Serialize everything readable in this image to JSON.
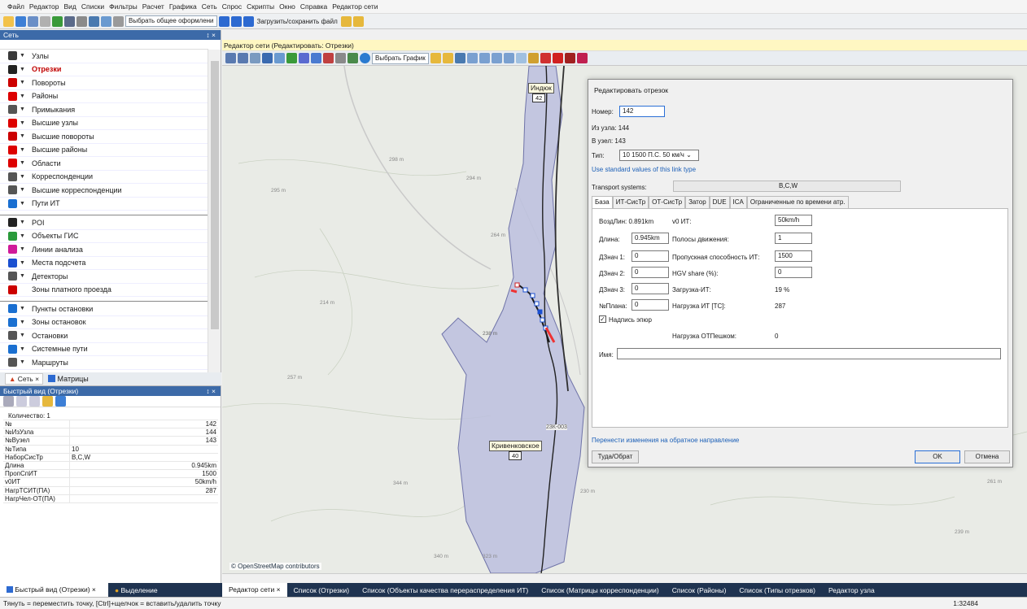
{
  "menubar": [
    "Файл",
    "Редактор",
    "Вид",
    "Списки",
    "Фильтры",
    "Расчет",
    "Графика",
    "Сеть",
    "Спрос",
    "Скрипты",
    "Окно",
    "Справка",
    "Редактор сети"
  ],
  "toolbar": {
    "layout_combo": "Выбрать общее оформлени",
    "load_save": "Загрузить/сохранить файл"
  },
  "net_pane": {
    "title": "Сеть",
    "pin": "↕ ×"
  },
  "net_items": [
    {
      "label": "Узлы",
      "icon": "node-arrow-icon",
      "color": "#3a3a3a"
    },
    {
      "label": "Отрезки",
      "icon": "link-icon",
      "color": "#222",
      "selected": true
    },
    {
      "label": "Повороты",
      "icon": "turn-icon",
      "color": "#c00"
    },
    {
      "label": "Районы",
      "icon": "zone-icon",
      "color": "#d00"
    },
    {
      "label": "Примыкания",
      "icon": "connector-icon",
      "color": "#555"
    },
    {
      "label": "Высшие узлы",
      "icon": "main-node-icon",
      "color": "#d00"
    },
    {
      "label": "Высшие повороты",
      "icon": "main-turn-icon",
      "color": "#c00"
    },
    {
      "label": "Высшие районы",
      "icon": "main-zone-icon",
      "color": "#d00"
    },
    {
      "label": "Области",
      "icon": "territory-icon",
      "color": "#d00"
    },
    {
      "label": "Корреспонденции",
      "icon": "od-pair-icon",
      "color": "#555"
    },
    {
      "label": "Высшие корреспонденции",
      "icon": "main-od-pair-icon",
      "color": "#555"
    },
    {
      "label": "Пути ИТ",
      "icon": "path-icon",
      "color": "#1a6fd1"
    },
    {
      "sep": true
    },
    {
      "label": "POI",
      "icon": "star-icon",
      "color": "#222"
    },
    {
      "label": "Объекты ГИС",
      "icon": "gis-icon",
      "color": "#2a9a3a"
    },
    {
      "label": "Линии анализа",
      "icon": "screenline-icon",
      "color": "#d01a9a"
    },
    {
      "label": "Места подсчета",
      "icon": "count-location-icon",
      "color": "#1a4fd1"
    },
    {
      "label": "Детекторы",
      "icon": "detector-icon",
      "color": "#555"
    },
    {
      "label": "Зоны платного проезда",
      "icon": "toll-icon",
      "color": "#c00",
      "nofilter": true
    },
    {
      "sep": true
    },
    {
      "label": "Пункты остановки",
      "icon": "stop-point-icon",
      "color": "#1a6fd1"
    },
    {
      "label": "Зоны остановок",
      "icon": "stop-area-icon",
      "color": "#1a6fd1"
    },
    {
      "label": "Остановки",
      "icon": "stop-icon",
      "color": "#555"
    },
    {
      "label": "Системные пути",
      "icon": "sys-route-icon",
      "color": "#1a6fd1"
    },
    {
      "label": "Маршруты",
      "icon": "line-icon",
      "color": "#555"
    }
  ],
  "net_tabs": {
    "net": "Сеть",
    "matrices": "Матрицы"
  },
  "quick_view": {
    "title": "Быстрый вид (Отрезки)",
    "count": "Количество: 1",
    "rows": [
      {
        "k": "№",
        "v": "142"
      },
      {
        "k": "№ИзУзла",
        "v": "144"
      },
      {
        "k": "№Вузел",
        "v": "143"
      },
      {
        "k": "№Типа",
        "v": "10",
        "left": true
      },
      {
        "k": "НаборСисТр",
        "v": "B,C,W",
        "left": true
      },
      {
        "k": "Длина",
        "v": "0.945km"
      },
      {
        "k": "ПропСпИТ",
        "v": "1500"
      },
      {
        "k": "v0ИТ",
        "v": "50km/h"
      },
      {
        "k": "НагрТСИТ(ПА)",
        "v": "287"
      },
      {
        "k": "НагрЧел-ОТ(ПА)",
        "v": ""
      }
    ]
  },
  "editor": {
    "header": "Редактор сети (Редактировать: Отрезки)",
    "graphic_combo": "Выбрать График"
  },
  "map": {
    "osm": "© OpenStreetMap contributors",
    "label_north": "Индюк",
    "num_north": "42",
    "label_south": "Кривенковское",
    "num_south": "40",
    "alt": [
      "298 m",
      "294 m",
      "295 m",
      "264 m",
      "214 m",
      "238 m",
      "257 m",
      "344 m",
      "230 m",
      "340 m",
      "323 m",
      "239 m",
      "261 m"
    ],
    "road": "23К-003"
  },
  "dialog": {
    "title": "Редактировать отрезок",
    "number_label": "Номер:",
    "number": "142",
    "from_node": "Из узла: 144",
    "to_node": "В узел:  143",
    "type_label": "Тип:",
    "type_value": "10 1500 П.С. 50 км/ч",
    "std_link": "Use standard values of this link type",
    "tsys_label": "Transport systems:",
    "tsys_value": "B,C,W",
    "tabs": [
      "База",
      "ИТ-СисТр",
      "ОТ-СисТр",
      "Затор",
      "DUE",
      "ICA",
      "Ограниченные по времени атр."
    ],
    "fields": {
      "air_dist": "ВоздЛин: 0.891km",
      "length_label": "Длина:",
      "length": "0.945km",
      "add1_label": "ДЗнач 1:",
      "add1": "0",
      "add2_label": "ДЗнач 2:",
      "add2": "0",
      "add3_label": "ДЗнач 3:",
      "add3": "0",
      "plan_label": "№Плана:",
      "plan": "0",
      "v0_label": "v0 ИТ:",
      "v0": "50km/h",
      "lanes_label": "Полосы движения:",
      "lanes": "1",
      "cap_label": "Пропускная способность ИТ:",
      "cap": "1500",
      "hgv_label": "HGV share (%):",
      "hgv": "0",
      "sat_label": "Загрузка-ИТ:",
      "sat": "19 %",
      "vol_label": "Нагрузка ИТ [ТС]:",
      "vol": "287",
      "bar_label": "Надпись эпюр",
      "pt_label": "Нагрузка ОТПешком:",
      "pt": "0",
      "name_label": "Имя:",
      "name": ""
    },
    "apply_reverse": "Перенести изменения на обратное направление",
    "to_from": "Туда/Обрат",
    "ok": "OK",
    "cancel": "Отмена"
  },
  "bottom_tabs": [
    "Быстрый вид (Отрезки)",
    "Выделение"
  ],
  "editor_tabs": [
    "Редактор сети",
    "Список (Отрезки)",
    "Список (Объекты качества перераспределения ИТ)",
    "Список (Матрицы корреспонденции)",
    "Список (Районы)",
    "Список (Типы отрезков)",
    "Редактор узла"
  ],
  "status": "Тянуть = переместить точку, [Ctrl]+щелчок = вставить/удалить точку",
  "scale": "1:32484"
}
